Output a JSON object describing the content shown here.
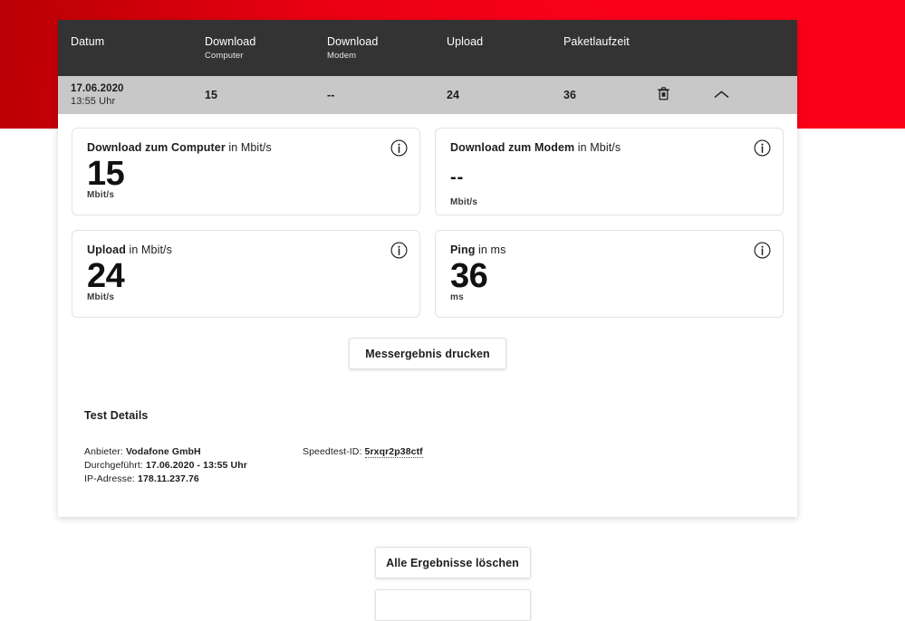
{
  "theme": {
    "brand_red_dark": "#b80006",
    "brand_red_bright": "#fa0019",
    "header_bar": "#333333",
    "row_selected": "#c8c8c8",
    "panel": "#ffffff"
  },
  "table": {
    "columns": [
      {
        "label": "Datum",
        "sub": ""
      },
      {
        "label": "Download",
        "sub": "Computer"
      },
      {
        "label": "Download",
        "sub": "Modem"
      },
      {
        "label": "Upload",
        "sub": ""
      },
      {
        "label": "Paketlaufzeit",
        "sub": ""
      }
    ],
    "row": {
      "date": "17.06.2020",
      "time": "13:55 Uhr",
      "download_computer": "15",
      "download_modem": "--",
      "upload": "24",
      "ping": "36",
      "delete_icon": "trash-icon",
      "expand_icon": "chevron-up-icon"
    }
  },
  "metrics": [
    {
      "title_strong": "Download zum Computer",
      "title_rest": " in Mbit/s",
      "value": "15",
      "unit": "Mbit/s",
      "empty": false,
      "info_icon": "info-icon"
    },
    {
      "title_strong": "Download zum Modem",
      "title_rest": " in Mbit/s",
      "value": "--",
      "unit": "Mbit/s",
      "empty": true,
      "info_icon": "info-icon"
    },
    {
      "title_strong": "Upload",
      "title_rest": " in Mbit/s",
      "value": "24",
      "unit": "Mbit/s",
      "empty": false,
      "info_icon": "info-icon"
    },
    {
      "title_strong": "Ping",
      "title_rest": " in ms",
      "value": "36",
      "unit": "ms",
      "empty": false,
      "info_icon": "info-icon"
    }
  ],
  "print_button_label": "Messergebnis drucken",
  "test_details": {
    "title": "Test Details",
    "provider_label": "Anbieter:",
    "provider_value": "Vodafone GmbH",
    "performed_label": "Durchgeführt:",
    "performed_value": "17.06.2020 - 13:55 Uhr",
    "ip_label": "IP-Adresse:",
    "ip_value": "178.11.237.76",
    "speedtest_id_label": "Speedtest-ID:",
    "speedtest_id_value": "5rxqr2p38ctf"
  },
  "bottom_actions": {
    "clear_all_label": "Alle Ergebnisse löschen",
    "secondary_label": ""
  }
}
